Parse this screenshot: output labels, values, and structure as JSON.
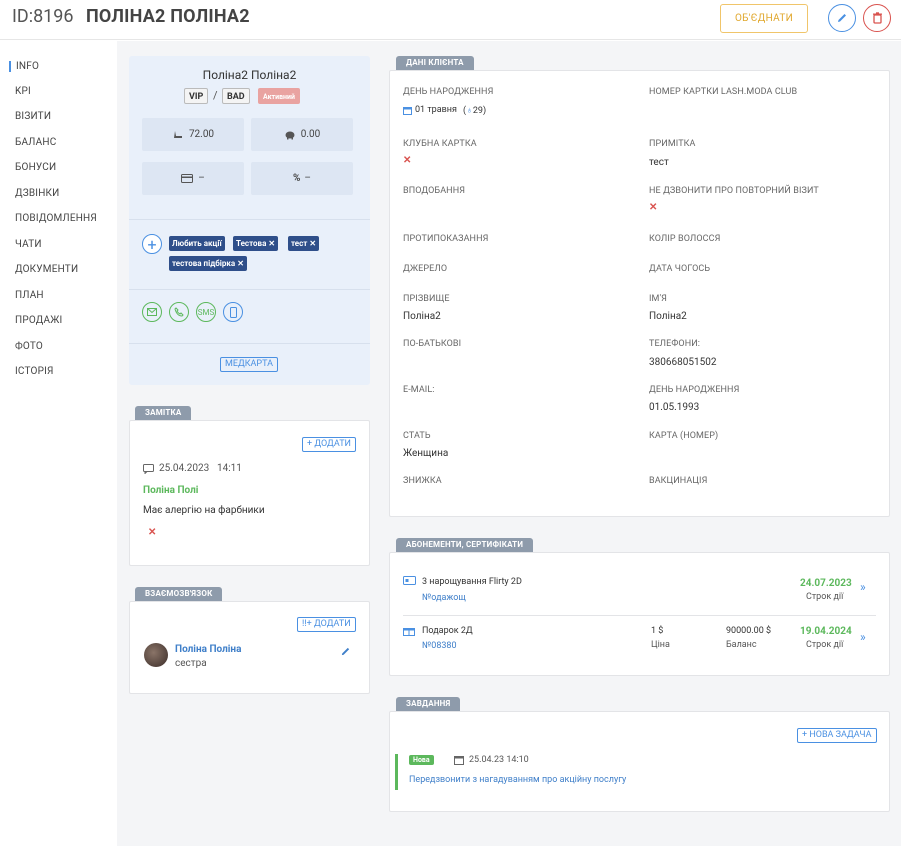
{
  "header": {
    "id": "ID:8196",
    "name": "ПОЛІНА2 ПОЛІНА2",
    "merge_label": "ОБ'ЄДНАТИ"
  },
  "sidebar": {
    "items": [
      {
        "label": "INFO"
      },
      {
        "label": "KPI"
      },
      {
        "label": "ВІЗИТИ"
      },
      {
        "label": "БАЛАНС"
      },
      {
        "label": "БОНУСИ"
      },
      {
        "label": "ДЗВІНКИ"
      },
      {
        "label": "ПОВІДОМЛЕННЯ"
      },
      {
        "label": "ЧАТИ"
      },
      {
        "label": "ДОКУМЕНТИ"
      },
      {
        "label": "ПЛАН"
      },
      {
        "label": "ПРОДАЖІ"
      },
      {
        "label": "ФОТО"
      },
      {
        "label": "ІСТОРІЯ"
      }
    ]
  },
  "profile": {
    "name": "Поліна2 Поліна2",
    "badge_vip": "VIP",
    "slash": "/",
    "badge_bad": "BAD",
    "status": "Активний",
    "stat1": "72.00",
    "stat2": "0.00",
    "stat3": "–",
    "stat4": "–",
    "tags": [
      "Любить акції",
      "Тестова",
      "тест",
      "тестова підбірка"
    ],
    "sms": "SMS",
    "medcard": "МЕДКАРТА"
  },
  "note": {
    "tab": "ЗАМІТКА",
    "add": "+ ДОДАТИ",
    "date": "25.04.2023",
    "time": "14:11",
    "author": "Поліна Полі",
    "text": "Має алергію на фарбники"
  },
  "relation": {
    "tab": "ВЗАЄМОЗВ'ЯЗОК",
    "add": "!!+ ДОДАТИ",
    "name": "Поліна Поліна",
    "role": "сестра"
  },
  "client": {
    "tab": "ДАНІ КЛІЄНТА",
    "birthday_label": "ДЕНЬ НАРОДЖЕННЯ",
    "birthday_value": "01 травня",
    "birthday_age": "29",
    "card_label": "НОМЕР КАРТКИ LASH.MODA CLUB",
    "club_label": "КЛУБНА КАРТКА",
    "note_label": "ПРИМІТКА",
    "note_value": "тест",
    "likes_label": "ВПОДОБАННЯ",
    "nocall_label": "НЕ ДЗВОНИТИ ПРО ПОВТОРНИЙ ВІЗИТ",
    "contra_label": "ПРОТИПОКАЗАННЯ",
    "hair_label": "КОЛІР ВОЛОССЯ",
    "source_label": "ДЖЕРЕЛО",
    "date_label": "ДАТА ЧОГОСЬ",
    "surname_label": "ПРІЗВИЩЕ",
    "surname_value": "Поліна2",
    "firstname_label": "ІМ'Я",
    "firstname_value": "Поліна2",
    "patronymic_label": "ПО-БАТЬКОВІ",
    "phones_label": "ТЕЛЕФОНИ:",
    "phones_value": "380668051502",
    "email_label": "E-MAIL:",
    "bday2_label": "ДЕНЬ НАРОДЖЕННЯ",
    "bday2_value": "01.05.1993",
    "gender_label": "СТАТЬ",
    "gender_value": "Женщина",
    "cardnum_label": "КАРТА (НОМЕР)",
    "discount_label": "ЗНИЖКА",
    "vacc_label": "ВАКЦИНАЦІЯ"
  },
  "subs": {
    "tab": "АБОНЕМЕНТИ, СЕРТИФІКАТИ",
    "items": [
      {
        "title": "3 нарощування Flirty 2D",
        "num": "№одажощ",
        "date": "24.07.2023",
        "date_label": "Строк дії"
      },
      {
        "title": "Подарок 2Д",
        "num": "№08380",
        "price": "1 $",
        "price_label": "Ціна",
        "balance": "90000.00 $",
        "balance_label": "Баланс",
        "date": "19.04.2024",
        "date_label": "Строк дії"
      }
    ]
  },
  "tasks": {
    "tab": "ЗАВДАННЯ",
    "add": "+ НОВА ЗАДАЧА",
    "status": "Нова",
    "datetime": "25.04.23 14:10",
    "text": "Передзвонити з нагадуванням про акційну послугу"
  },
  "colors": {
    "accent": "#4a90e2",
    "danger": "#d9534f",
    "success": "#5cb85c",
    "tag": "#2f4f8a"
  }
}
